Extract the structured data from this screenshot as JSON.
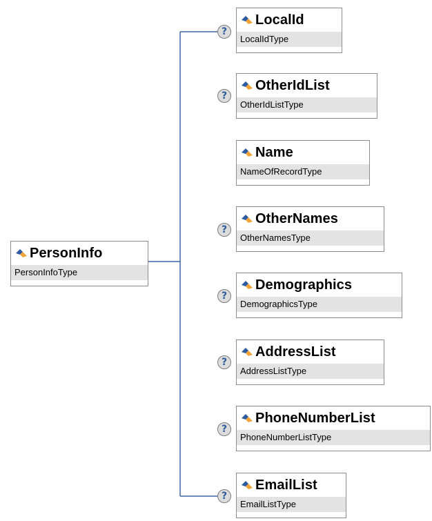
{
  "diagram": {
    "root": {
      "name": "PersonInfo",
      "type": "PersonInfoType"
    },
    "children": [
      {
        "name": "LocalId",
        "type": "LocalIdType",
        "optional": true
      },
      {
        "name": "OtherIdList",
        "type": "OtherIdListType",
        "optional": true
      },
      {
        "name": "Name",
        "type": "NameOfRecordType",
        "optional": false
      },
      {
        "name": "OtherNames",
        "type": "OtherNamesType",
        "optional": true
      },
      {
        "name": "Demographics",
        "type": "DemographicsType",
        "optional": true
      },
      {
        "name": "AddressList",
        "type": "AddressListType",
        "optional": true
      },
      {
        "name": "PhoneNumberList",
        "type": "PhoneNumberListType",
        "optional": true
      },
      {
        "name": "EmailList",
        "type": "EmailListType",
        "optional": true
      }
    ],
    "optional_marker": "?",
    "colors": {
      "connector": "#3b66a8",
      "box_border": "#8c8c8c",
      "type_band": "#e3e3e3"
    }
  }
}
